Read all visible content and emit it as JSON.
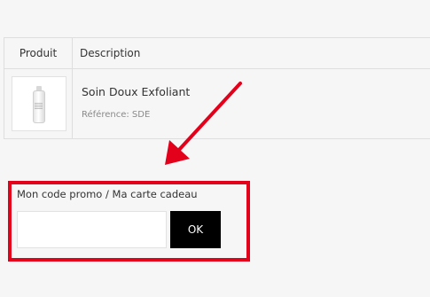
{
  "table": {
    "headers": {
      "product": "Produit",
      "description": "Description"
    },
    "items": [
      {
        "image_icon": "product-bottle-thumbnail",
        "name": "Soin Doux Exfoliant",
        "reference": "Référence: SDE"
      }
    ]
  },
  "promo": {
    "label": "Mon code promo / Ma carte cadeau",
    "input_value": "",
    "input_placeholder": "",
    "button_label": "OK"
  },
  "annotation": {
    "arrow_icon": "red-arrow-pointer",
    "highlight_color": "#e3001b"
  },
  "colors": {
    "button_bg": "#000000",
    "button_text": "#ffffff",
    "annotation_red": "#e3001b",
    "border": "#dedede"
  }
}
